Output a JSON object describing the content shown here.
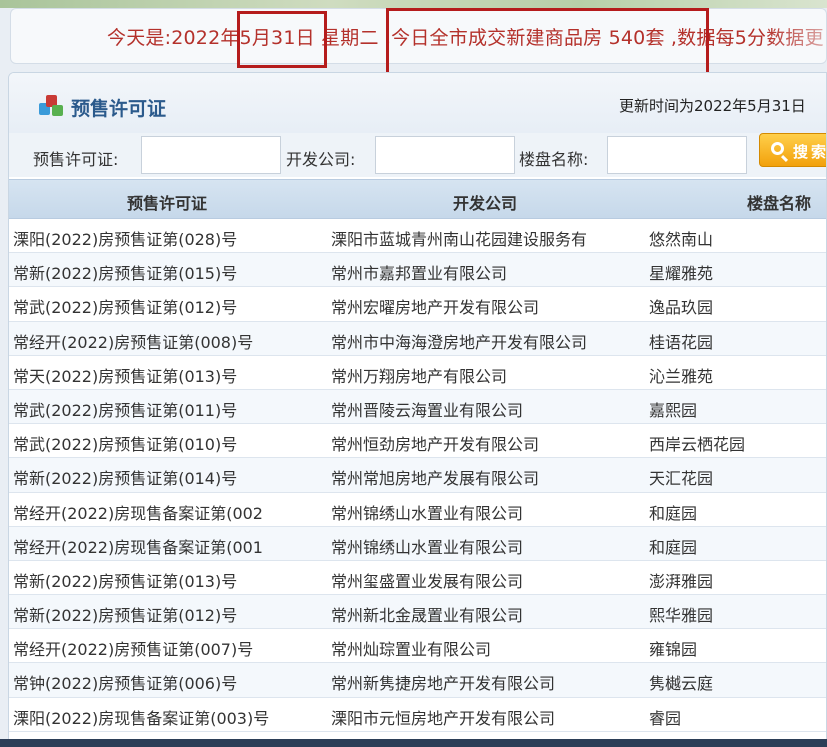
{
  "banner": {
    "text": "今天是:2022年5月31日 星期二 ,今日全市成交新建商品房 540套 ,数据每5分数据更"
  },
  "panel": {
    "title": "预售许可证",
    "update_time": "更新时间为2022年5月31日"
  },
  "search": {
    "permit_label": "预售许可证:",
    "permit_value": "",
    "developer_label": "开发公司:",
    "developer_value": "",
    "project_label": "楼盘名称:",
    "project_value": "",
    "button_label": "搜索"
  },
  "table": {
    "headers": [
      "预售许可证",
      "开发公司",
      "楼盘名称"
    ],
    "rows": [
      [
        "溧阳(2022)房预售证第(028)号",
        "溧阳市蓝城青州南山花园建设服务有",
        "悠然南山"
      ],
      [
        "常新(2022)房预售证第(015)号",
        "常州市嘉邦置业有限公司",
        "星耀雅苑"
      ],
      [
        "常武(2022)房预售证第(012)号",
        "常州宏曜房地产开发有限公司",
        "逸品玖园"
      ],
      [
        "常经开(2022)房预售证第(008)号",
        "常州市中海海澄房地产开发有限公司",
        "桂语花园"
      ],
      [
        "常天(2022)房预售证第(013)号",
        "常州万翔房地产有限公司",
        "沁兰雅苑"
      ],
      [
        "常武(2022)房预售证第(011)号",
        "常州晋陵云海置业有限公司",
        "嘉熙园"
      ],
      [
        "常武(2022)房预售证第(010)号",
        "常州恒劲房地产开发有限公司",
        "西岸云栖花园"
      ],
      [
        "常新(2022)房预售证第(014)号",
        "常州常旭房地产发展有限公司",
        "天汇花园"
      ],
      [
        "常经开(2022)房现售备案证第(002",
        "常州锦绣山水置业有限公司",
        "和庭园"
      ],
      [
        "常经开(2022)房现售备案证第(001",
        "常州锦绣山水置业有限公司",
        "和庭园"
      ],
      [
        "常新(2022)房预售证第(013)号",
        "常州玺盛置业发展有限公司",
        "澎湃雅园"
      ],
      [
        "常新(2022)房预售证第(012)号",
        "常州新北金晟置业有限公司",
        "熙华雅园"
      ],
      [
        "常经开(2022)房预售证第(007)号",
        "常州灿琮置业有限公司",
        "雍锦园"
      ],
      [
        "常钟(2022)房预售证第(006)号",
        "常州新隽捷房地产开发有限公司",
        "隽樾云庭"
      ],
      [
        "溧阳(2022)房现售备案证第(003)号",
        "溧阳市元恒房地产开发有限公司",
        "睿园"
      ]
    ]
  },
  "colors": {
    "banner_text": "#b4312b",
    "highlight_box": "#b51c1c",
    "title": "#2b5a8c",
    "search_button": "#f2a10c"
  }
}
